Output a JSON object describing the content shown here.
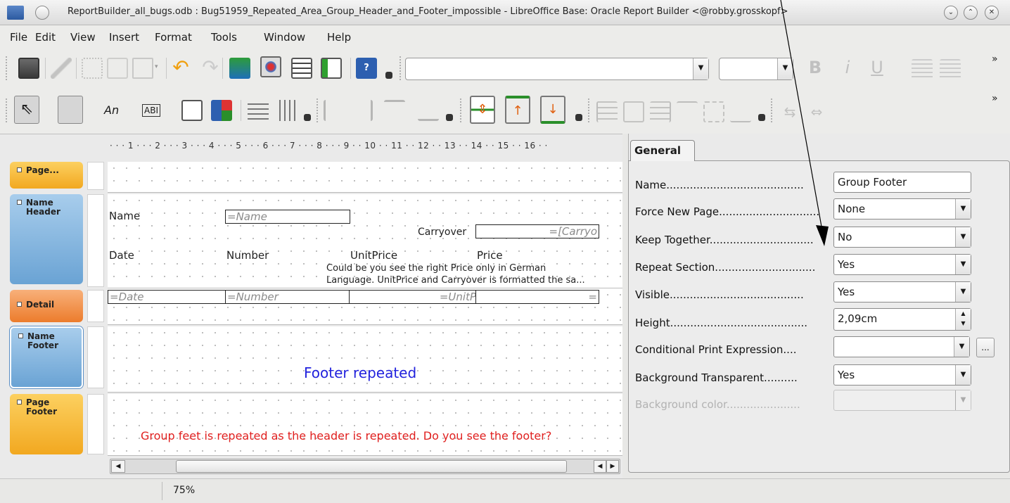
{
  "window": {
    "title": "ReportBuilder_all_bugs.odb : Bug51959_Repeated_Area_Group_Header_and_Footer_impossible - LibreOffice Base: Oracle Report Builder <@robby.grosskopf>"
  },
  "menu": [
    "File",
    "Edit",
    "View",
    "Insert",
    "Format",
    "Tools",
    "Window",
    "Help"
  ],
  "toolbar2": {
    "text_label": "An",
    "text_field": "ABI"
  },
  "ruler": "· · · 1 · · · 2 · · · 3 · · · 4 · · · 5 · · · 6 · · · 7 · · · 8 · · · 9 · · 10 · · 11 · · 12 · · 13 · · 14 · · 15 · · 16 · ·",
  "sections": {
    "page_header": "Page...",
    "name_header": "Name Header",
    "detail": "Detail",
    "name_footer": "Name Footer",
    "page_footer": "Page Footer"
  },
  "report": {
    "name_label": "Name",
    "name_field": "=Name",
    "carryover_label": "Carryover",
    "carryover_field": "=[Carryo",
    "col_date": "Date",
    "col_number": "Number",
    "col_unitprice": "UnitPrice",
    "col_price": "Price",
    "note_line1": "Could be you see the right Price only in German",
    "note_line2": "Language. UnitPrice and Carryover is formatted the sa...",
    "detail_date": "=Date",
    "detail_number": "=Number",
    "detail_unitprice": "=UnitP",
    "detail_price": "=",
    "footer_text": "Footer repeated",
    "page_footer_text": "Group feet is repeated as the header is repeated. Do you see the footer?"
  },
  "properties": {
    "tab": "General",
    "rows": [
      {
        "label": "Name.........................................",
        "value": "Group Footer"
      },
      {
        "label": "Force New Page..............................",
        "value": "None"
      },
      {
        "label": "Keep Together...............................",
        "value": "No"
      },
      {
        "label": "Repeat Section..............................",
        "value": "Yes"
      },
      {
        "label": "Visible........................................",
        "value": "Yes"
      },
      {
        "label": "Height.........................................",
        "value": "2,09cm"
      },
      {
        "label": "Conditional Print Expression....",
        "value": ""
      },
      {
        "label": "Background Transparent..........",
        "value": "Yes"
      },
      {
        "label": "Background color......................",
        "value": ""
      }
    ],
    "ellipsis": "..."
  },
  "status": {
    "zoom": "75%"
  },
  "colors": {
    "page_section": "#f7b21c",
    "group_section": "#7fb4de",
    "detail_section": "#f08a3a",
    "footer_text": "#2222dd",
    "page_footer_text": "#e0201f"
  }
}
